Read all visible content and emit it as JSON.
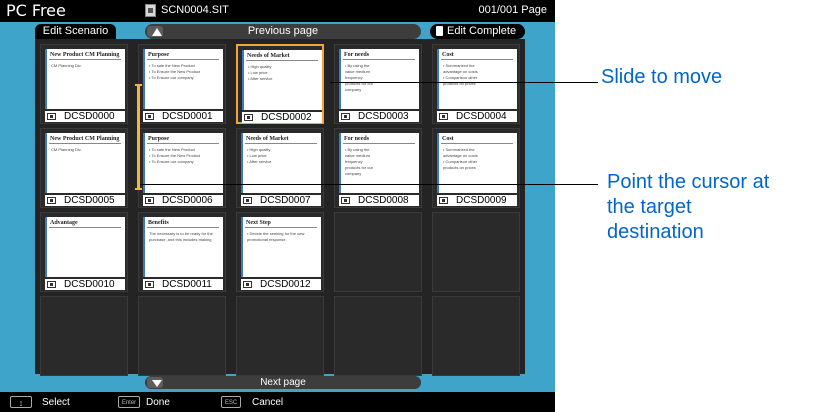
{
  "header": {
    "app_title": "PC Free",
    "file_name": "SCN0004.SIT",
    "page_count": "001/001 Page"
  },
  "tabs": {
    "edit_scenario": "Edit Scenario",
    "previous_page": "Previous page",
    "edit_complete": "Edit Complete"
  },
  "slides": [
    {
      "label": "DCSD0000",
      "title": "New Product CM Planning",
      "lines": [
        "CM Planning Div."
      ]
    },
    {
      "label": "DCSD0001",
      "title": "Purpose",
      "lines": [
        "• To sale the New Product",
        "• To Ensure the New Product",
        "• To Ensure our company"
      ]
    },
    {
      "label": "DCSD0002",
      "title": "Needs of Market",
      "lines": [
        "• High quality",
        "• Low price",
        "• After service"
      ]
    },
    {
      "label": "DCSD0003",
      "title": "For needs",
      "lines": [
        "• By using the",
        "value medium",
        "frequency",
        "products for our",
        "company"
      ]
    },
    {
      "label": "DCSD0004",
      "title": "Cost",
      "lines": [
        "• Summarized the",
        "advantage on costs",
        "• Comparison other",
        "products on prices"
      ]
    },
    {
      "label": "DCSD0005",
      "title": "New Product CM Planning",
      "lines": [
        "CM Planning Div."
      ]
    },
    {
      "label": "DCSD0006",
      "title": "Purpose",
      "lines": [
        "• To sale the New Product",
        "• To Ensure the New Product",
        "• To Ensure our company"
      ]
    },
    {
      "label": "DCSD0007",
      "title": "Needs of Market",
      "lines": [
        "• High quality",
        "• Low price",
        "• After service"
      ]
    },
    {
      "label": "DCSD0008",
      "title": "For needs",
      "lines": [
        "• By using the",
        "value medium",
        "frequency",
        "products for our",
        "company"
      ]
    },
    {
      "label": "DCSD0009",
      "title": "Cost",
      "lines": [
        "• Summarized the",
        "advantage on costs",
        "• Comparison other",
        "products on prices"
      ]
    },
    {
      "label": "DCSD0010",
      "title": "Advantage",
      "lines": []
    },
    {
      "label": "DCSD0011",
      "title": "Benefits",
      "lines": [
        "The necessary is to be ready for the",
        "purchase, and this includes making"
      ]
    },
    {
      "label": "DCSD0012",
      "title": "Next Step",
      "lines": [
        "• Decide the seeking for the new",
        "promotional response."
      ]
    }
  ],
  "next_page": "Next page",
  "footer": {
    "select_key": "↕",
    "select_label": "Select",
    "enter_key": "Enter",
    "enter_label": "Done",
    "esc_key": "ESC",
    "esc_label": "Cancel"
  },
  "callouts": {
    "slide_to_move": "Slide to move",
    "point_cursor_line1": "Point the cursor at",
    "point_cursor_line2": "the target",
    "point_cursor_line3": "destination"
  },
  "colors": {
    "background": "#3ea4c9",
    "panel": "#242424",
    "selection": "#f0a43a",
    "callout_text": "#0066cc"
  }
}
